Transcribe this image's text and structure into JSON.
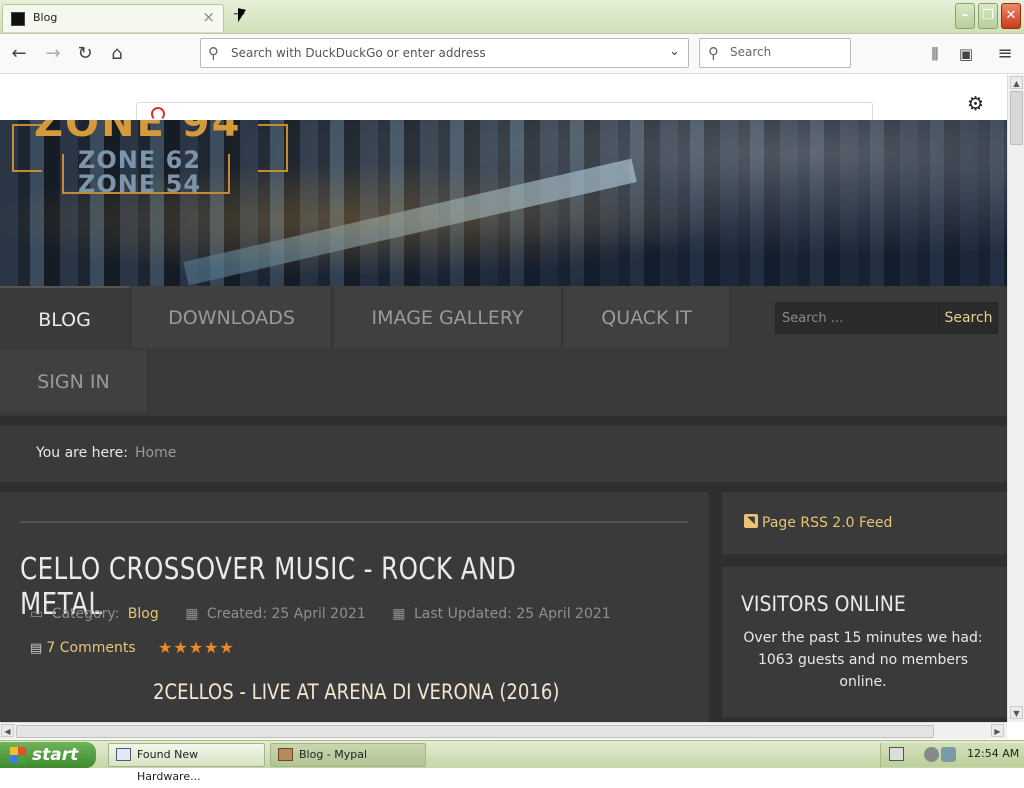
{
  "browser": {
    "tab_title": "Blog",
    "tab_close": "×",
    "new_tab": "+",
    "url_placeholder": "Search with DuckDuckGo or enter address",
    "search_placeholder": "Search"
  },
  "site": {
    "logo_lines": [
      "ZONE 94",
      "ZONE 62",
      "ZONE 54"
    ],
    "menu": [
      "BLOG",
      "DOWNLOADS",
      "IMAGE GALLERY",
      "QUACK IT",
      "SIGN IN"
    ],
    "search_placeholder": "Search ...",
    "search_button": "Search",
    "breadcrumb_label": "You are here:",
    "breadcrumb_home": "Home"
  },
  "article": {
    "title": "CELLO CROSSOVER MUSIC - ROCK AND METAL",
    "category_label": "Category:",
    "category": "Blog",
    "created": "Created: 25 April 2021",
    "updated": "Last Updated: 25 April 2021",
    "comments": "7 Comments",
    "rating": "★★★★★",
    "video_title": "2CELLOS - LIVE AT ARENA DI VERONA (2016)"
  },
  "sidebar": {
    "rss": "Page RSS 2.0 Feed",
    "visitors_title": "VISITORS ONLINE",
    "visitors_text": "Over the past 15 minutes we had: 1063 guests and no members online."
  },
  "taskbar": {
    "start": "start",
    "tasks": [
      "Found New Hardware...",
      "Blog - Mypal"
    ],
    "clock": "12:54 AM"
  },
  "colors": {
    "accent": "#e8c474",
    "star": "#f08a22",
    "site_bg": "#3a3a3a"
  }
}
